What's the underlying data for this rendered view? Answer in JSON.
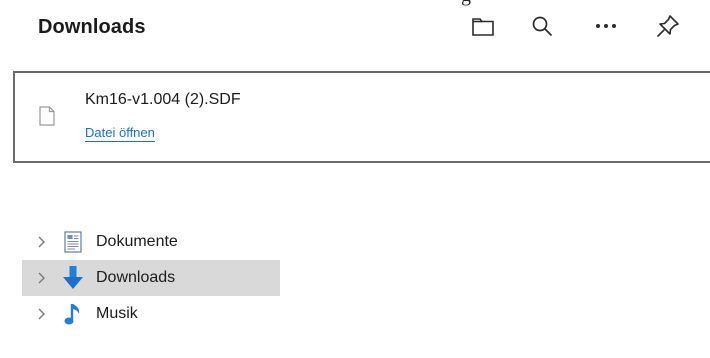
{
  "panel": {
    "title": "Downloads",
    "cutoff_glyph": "g",
    "icons": [
      "folder-icon",
      "search-icon",
      "more-icon",
      "pin-icon"
    ]
  },
  "download": {
    "file_name": "Km16-v1.004 (2).SDF",
    "open_label": "Datei öffnen",
    "link_color": "#1a6fd1"
  },
  "tree": {
    "items": [
      {
        "label": "Dokumente",
        "icon": "documents-icon",
        "selected": false
      },
      {
        "label": "Downloads",
        "icon": "downloads-arrow-icon",
        "selected": true
      },
      {
        "label": "Musik",
        "icon": "music-note-icon",
        "selected": false
      }
    ],
    "selected_color": "#d9d9d9"
  }
}
